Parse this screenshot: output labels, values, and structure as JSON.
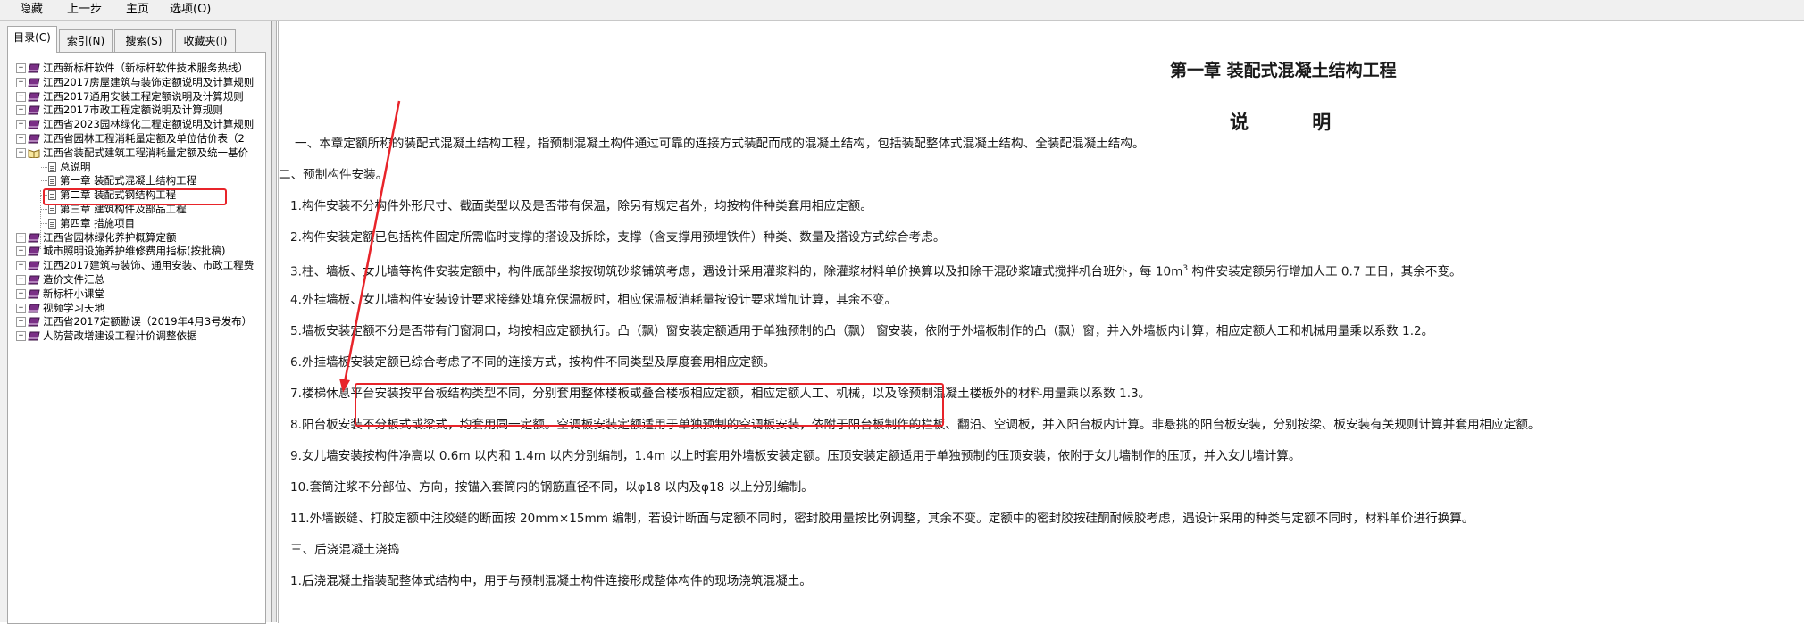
{
  "toolbar": {
    "hide": "隐藏",
    "back": "上一步",
    "home": "主页",
    "options": "选项(O)"
  },
  "tabs": {
    "contents": "目录(C)",
    "index": "索引(N)",
    "search": "搜索(S)",
    "favorites": "收藏夹(I)"
  },
  "tree": {
    "items": [
      {
        "label": "江西新标杆软件（新标杆软件技术服务热线）"
      },
      {
        "label": "江西2017房屋建筑与装饰定额说明及计算规则"
      },
      {
        "label": "江西2017通用安装工程定额说明及计算规则"
      },
      {
        "label": "江西2017市政工程定额说明及计算规则"
      },
      {
        "label": "江西省2023园林绿化工程定额说明及计算规则"
      },
      {
        "label": "江西省园林工程消耗量定额及单位估价表（2"
      },
      {
        "label": "江西省装配式建筑工程消耗量定额及统一基价"
      },
      {
        "label": "总说明"
      },
      {
        "label": "第一章 装配式混凝土结构工程"
      },
      {
        "label": "第二章 装配式钢结构工程"
      },
      {
        "label": "第三章 建筑构件及部品工程"
      },
      {
        "label": "第四章 措施项目"
      },
      {
        "label": "江西省园林绿化养护概算定额"
      },
      {
        "label": "城市照明设施养护维修费用指标(按批稿)"
      },
      {
        "label": "江西2017建筑与装饰、通用安装、市政工程费"
      },
      {
        "label": "造价文件汇总"
      },
      {
        "label": "新标杆小课堂"
      },
      {
        "label": "视频学习天地"
      },
      {
        "label": "江西省2017定额勘误（2019年4月3号发布）"
      },
      {
        "label": "人防营改增建设工程计价调整依据"
      }
    ]
  },
  "doc": {
    "chapter_title": "第一章 装配式混凝土结构工程",
    "subtitle": "说 明",
    "p1": "一、本章定额所称的装配式混凝土结构工程，指预制混凝土构件通过可靠的连接方式装配而成的混凝土结构，包括装配整体式混凝土结构、全装配混凝土结构。",
    "p2": "二、预制构件安装。",
    "p3": "1.构件安装不分构件外形尺寸、截面类型以及是否带有保温，除另有规定者外，均按构件种类套用相应定额。",
    "p4": "2.构件安装定额已包括构件固定所需临时支撑的搭设及拆除，支撑（含支撑用预埋铁件）种类、数量及搭设方式综合考虑。",
    "p5a": "3.柱、墙板、女儿墙等构件安装定额中，构件底部坐浆按砌筑砂浆铺筑考虑，遇设计采用灌浆料的，除灌浆材料单价换算以及扣除干混砂浆罐式搅拌机台班外，每 10m",
    "p5sup": "3",
    "p5b": " 构件安装定额另行增加人工 0.7 工日，其余不变。",
    "p6": "4.外挂墙板、女儿墙构件安装设计要求接缝处填充保温板时，相应保温板消耗量按设计要求增加计算，其余不变。",
    "p7": "5.墙板安装定额不分是否带有门窗洞口，均按相应定额执行。凸（飘）窗安装定额适用于单独预制的凸（飘） 窗安装，依附于外墙板制作的凸（飘）窗，并入外墙板内计算，相应定额人工和机械用量乘以系数 1.2。",
    "p8": "6.外挂墙板安装定额已综合考虑了不同的连接方式，按构件不同类型及厚度套用相应定额。",
    "p9": "7.楼梯休息平台安装按平台板结构类型不同，分别套用整体楼板或叠合楼板相应定额，相应定额人工、机械，以及除预制混凝土楼板外的材料用量乘以系数 1.3。",
    "p10": "8.阳台板安装不分板式或梁式，均套用同一定额。空调板安装定额适用于单独预制的空调板安装，依附于阳台板制作的栏板、翻沿、空调板，并入阳台板内计算。非悬挑的阳台板安装，分别按梁、板安装有关规则计算并套用相应定额。",
    "p11": "9.女儿墙安装按构件净高以 0.6m 以内和 1.4m 以内分别编制，1.4m 以上时套用外墙板安装定额。压顶安装定额适用于单独预制的压顶安装，依附于女儿墙制作的压顶，并入女儿墙计算。",
    "p12": "10.套筒注浆不分部位、方向，按锚入套筒内的钢筋直径不同，以φ18 以内及φ18 以上分别编制。",
    "p13": "11.外墙嵌缝、打胶定额中注胶缝的断面按 20mm×15mm 编制，若设计断面与定额不同时，密封胶用量按比例调整，其余不变。定额中的密封胶按硅酮耐候胶考虑，遇设计采用的种类与定额不同时，材料单价进行换算。",
    "p14": "三、后浇混凝土浇捣",
    "p15": "1.后浇混凝土指装配整体式结构中，用于与预制混凝土构件连接形成整体构件的现场浇筑混凝土。"
  },
  "annotation_color": "#e8242a"
}
